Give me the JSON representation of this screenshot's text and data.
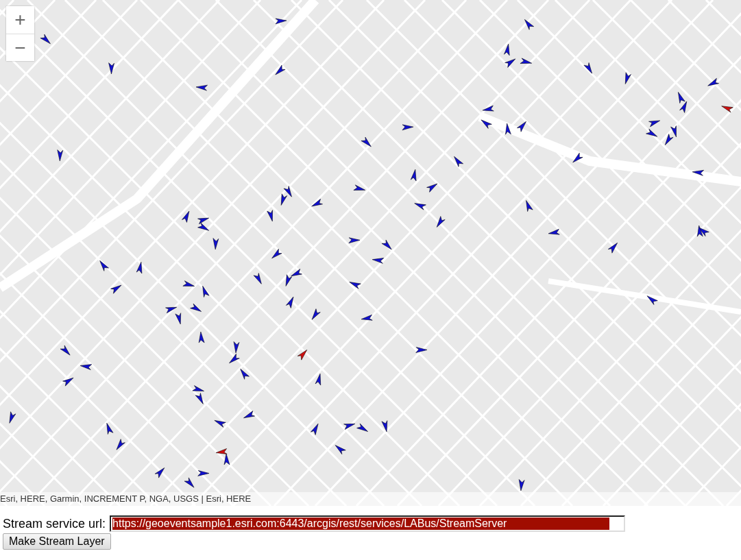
{
  "map": {
    "zoom_in": "+",
    "zoom_out": "−",
    "attribution": "Esri, HERE, Garmin, INCREMENT P, NGA, USGS | Esri, HERE"
  },
  "form": {
    "label": "Stream service url:",
    "url_value": "https://geoeventsample1.esri.com:6443/arcgis/rest/services/LABus/StreamServer",
    "button": "Make Stream Layer"
  }
}
